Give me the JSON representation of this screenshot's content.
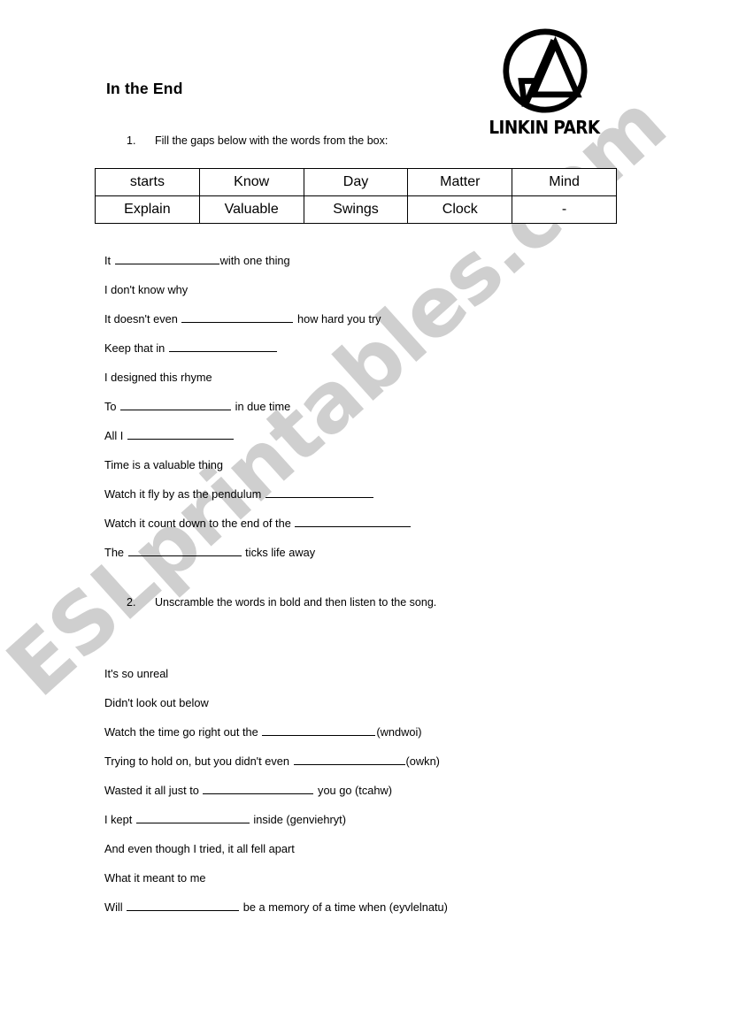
{
  "document": {
    "title": "In the End",
    "logo": {
      "mark_name": "linkin-park-logo",
      "wordmark": "LINKIN PARK"
    },
    "watermark": "ESLprintables.com"
  },
  "exercise_1": {
    "number": "1.",
    "instruction": "Fill the gaps below with the words from the box:",
    "word_box": {
      "rows": [
        [
          "starts",
          "Know",
          "Day",
          "Matter",
          "Mind"
        ],
        [
          "Explain",
          "Valuable",
          "Swings",
          "Clock",
          "-"
        ]
      ]
    },
    "lines": [
      {
        "before": "It ",
        "blank": 118,
        "after": "with one thing"
      },
      {
        "before": "I don't know why",
        "blank": 0,
        "after": ""
      },
      {
        "before": "It doesn't even ",
        "blank": 126,
        "after": " how hard you try"
      },
      {
        "before": "Keep that in ",
        "blank": 122,
        "after": ""
      },
      {
        "before": "I designed this rhyme",
        "blank": 0,
        "after": ""
      },
      {
        "before": "To ",
        "blank": 125,
        "after": " in due time"
      },
      {
        "before": "All I ",
        "blank": 120,
        "after": ""
      },
      {
        "before": "Time is a valuable thing",
        "blank": 0,
        "after": ""
      },
      {
        "before": "Watch it fly by as the pendulum ",
        "blank": 122,
        "after": ""
      },
      {
        "before": "Watch it count down to the end of the ",
        "blank": 131,
        "after": ""
      },
      {
        "before": "The ",
        "blank": 128,
        "after": " ticks life away"
      }
    ]
  },
  "exercise_2": {
    "number": "2.",
    "instruction": "Unscramble the words in bold and then listen to the song.",
    "lines": [
      {
        "before": "It's so unreal",
        "blank": 0,
        "after": ""
      },
      {
        "before": "Didn't look out below",
        "blank": 0,
        "after": ""
      },
      {
        "before": "Watch the time go right out the ",
        "blank": 128,
        "after": "(wndwoi)"
      },
      {
        "before": "Trying to hold on, but you didn't even ",
        "blank": 126,
        "after": "(owkn)"
      },
      {
        "before": "Wasted it all just to ",
        "blank": 125,
        "after": " you go (tcahw)"
      },
      {
        "before": "I kept ",
        "blank": 128,
        "after": " inside (genviehryt)"
      },
      {
        "before": "And even though I tried, it all fell apart",
        "blank": 0,
        "after": ""
      },
      {
        "before": "What it meant to me",
        "blank": 0,
        "after": ""
      },
      {
        "before": "Will ",
        "blank": 127,
        "after": " be a memory of a time when (eyvlelnatu)"
      }
    ]
  },
  "colors": {
    "text": "#000000",
    "page_background": "#ffffff",
    "watermark": "#8c8c8c",
    "table_border": "#000000"
  }
}
